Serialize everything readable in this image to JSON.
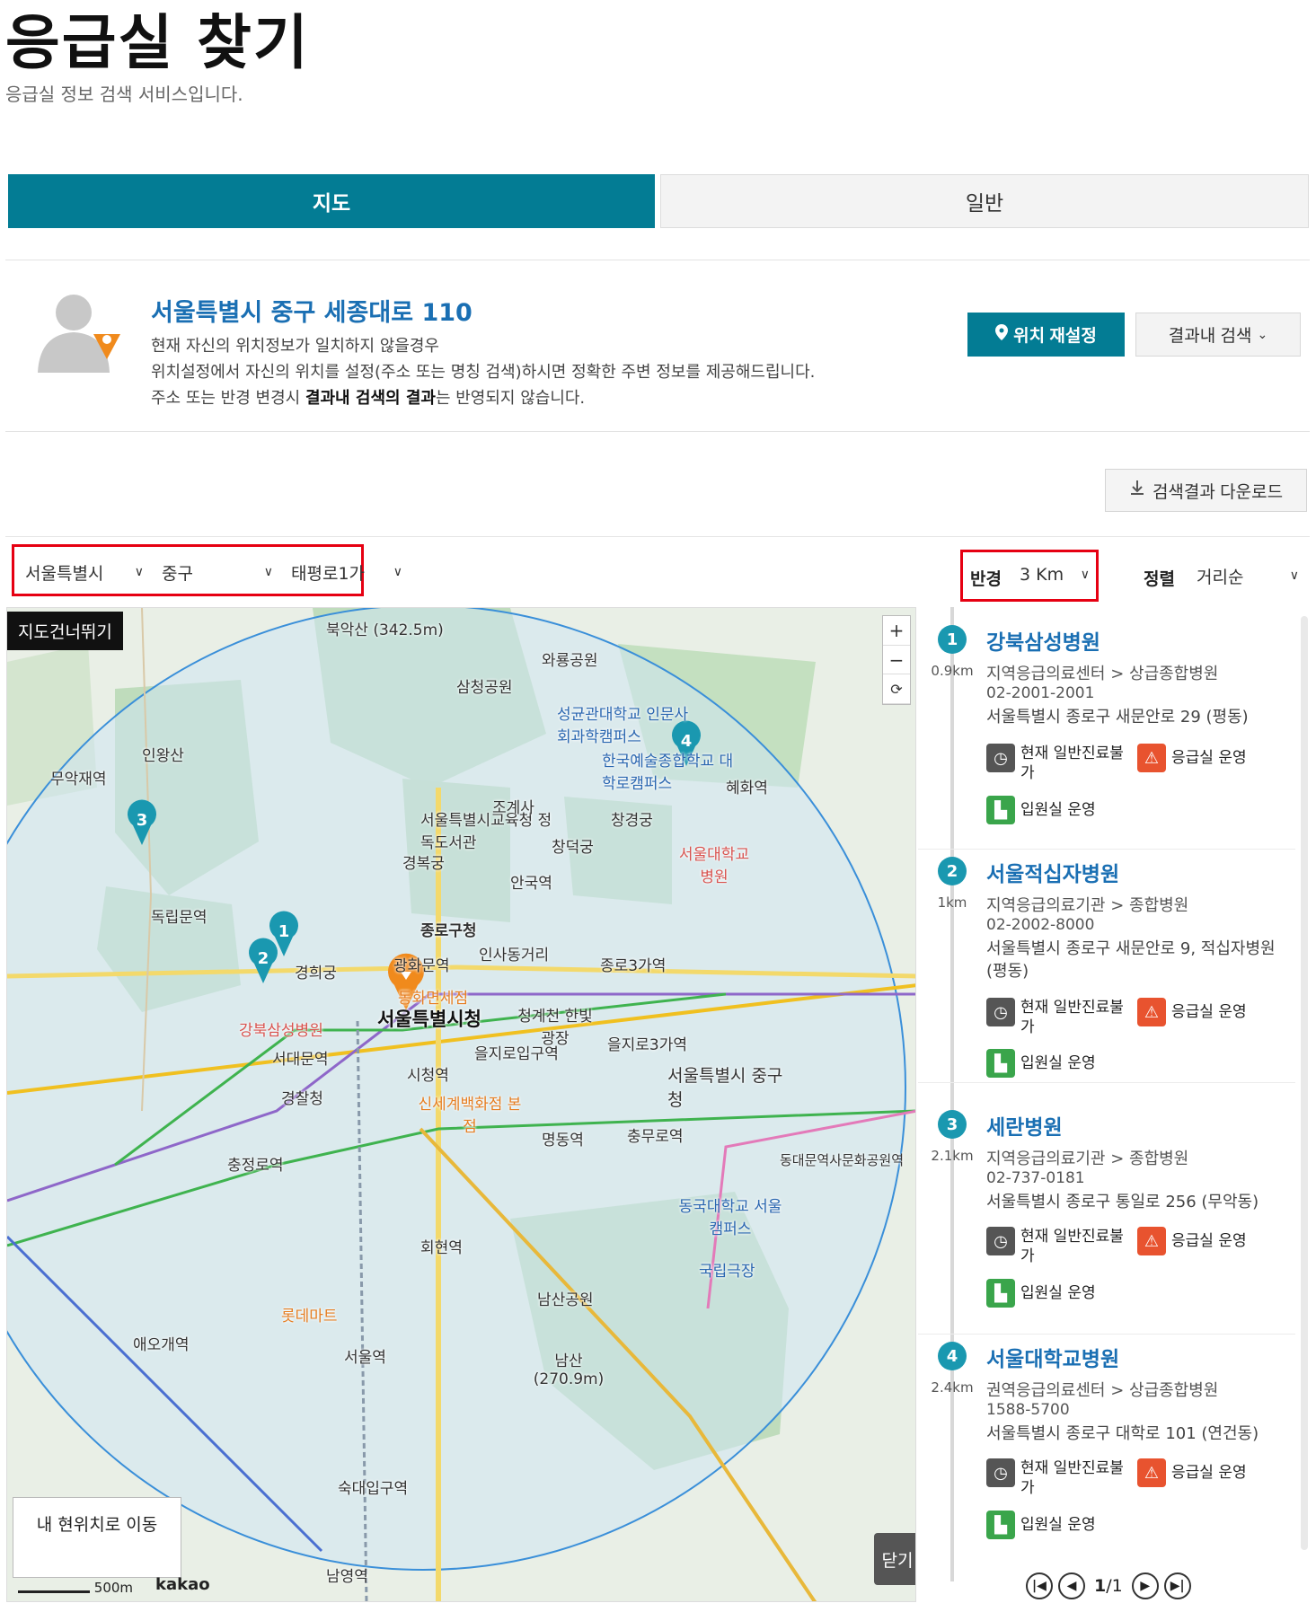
{
  "page": {
    "title": "응급실 찾기",
    "description": "응급실 정보 검색 서비스입니다."
  },
  "tabs": [
    {
      "label": "지도",
      "active": true
    },
    {
      "label": "일반",
      "active": false
    }
  ],
  "location": {
    "address": "서울특별시 중구 세종대로 110",
    "notice_line1": "현재 자신의 위치정보가 일치하지 않을경우",
    "notice_line2": "위치설정에서 자신의 위치를 설정(주소 또는 명칭 검색)하시면 정확한 주변 정보를 제공해드립니다.",
    "notice_line3_pre": "주소 또는 반경 변경시 ",
    "notice_line3_bold": "결과내 검색의 결과",
    "notice_line3_post": "는 반영되지 않습니다.",
    "reset_button": "위치 재설정",
    "within_search_button": "결과내 검색"
  },
  "download_button": "검색결과 다운로드",
  "filters": {
    "city": "서울특별시",
    "district": "중구",
    "dong": "태평로1가",
    "radius_label": "반경",
    "radius_value": "3 Km",
    "sort_label": "정렬",
    "sort_value": "거리순"
  },
  "map": {
    "skip_link": "지도건너뛰기",
    "my_location_button": "내 현위치로 이동",
    "close_button": "닫기",
    "scale": "500m",
    "provider": "kakao",
    "center_label": "서울특별시청",
    "labels": [
      "북악산 (342.5m)",
      "와룡공원",
      "삼청공원",
      "성균관대학교 인문사회과학캠퍼스",
      "인왕산",
      "한국예술종합학교 대학로캠퍼스",
      "서울특별시교육청 정독도서관",
      "창경궁",
      "창덕궁",
      "조계사",
      "경복궁",
      "안국역",
      "종로구청",
      "인사동거리",
      "종로3가역",
      "서울대학교병원",
      "광화문역",
      "경희궁",
      "강북삼성병원",
      "서대문역",
      "경찰청",
      "시청역",
      "신세계백화점 본점",
      "을지로입구역",
      "을지로3가역",
      "서울특별시 중구청",
      "명동역",
      "충무로역",
      "서울역",
      "남산공원",
      "남산 (270.9m)",
      "숙대입구역",
      "롯데마트",
      "동국대학교 서울캠퍼스",
      "국립극장",
      "독립문역",
      "충정로역",
      "애오개역",
      "남영역",
      "회현역",
      "동대문역사문화공원역",
      "동화면세점",
      "청계천 한빛광장",
      "무악재역",
      "혜화역"
    ],
    "markers": [
      "1",
      "2",
      "3",
      "4"
    ]
  },
  "results": [
    {
      "num": "1",
      "distance": "0.9km",
      "name": "강북삼성병원",
      "category": "지역응급의료센터 > 상급종합병원",
      "phone": "02-2001-2001",
      "address": "서울특별시 종로구 새문안로 29 (평동)",
      "status_clinic": "현재 일반진료불가",
      "status_er": "응급실 운영",
      "status_ward": "입원실 운영"
    },
    {
      "num": "2",
      "distance": "1km",
      "name": "서울적십자병원",
      "category": "지역응급의료기관 > 종합병원",
      "phone": "02-2002-8000",
      "address": "서울특별시 종로구 새문안로 9, 적십자병원 (평동)",
      "status_clinic": "현재 일반진료불가",
      "status_er": "응급실 운영",
      "status_ward": "입원실 운영"
    },
    {
      "num": "3",
      "distance": "2.1km",
      "name": "세란병원",
      "category": "지역응급의료기관 > 종합병원",
      "phone": "02-737-0181",
      "address": "서울특별시 종로구 통일로 256 (무악동)",
      "status_clinic": "현재 일반진료불가",
      "status_er": "응급실 운영",
      "status_ward": "입원실 운영"
    },
    {
      "num": "4",
      "distance": "2.4km",
      "name": "서울대학교병원",
      "category": "권역응급의료센터 > 상급종합병원",
      "phone": "1588-5700",
      "address": "서울특별시 종로구 대학로 101 (연건동)",
      "status_clinic": "현재 일반진료불가",
      "status_er": "응급실 운영",
      "status_ward": "입원실 운영"
    }
  ],
  "pagination": {
    "current": "1",
    "total": "/1"
  },
  "colors": {
    "primary": "#037c94",
    "link": "#1a6fb3",
    "highlight": "#e60012"
  }
}
